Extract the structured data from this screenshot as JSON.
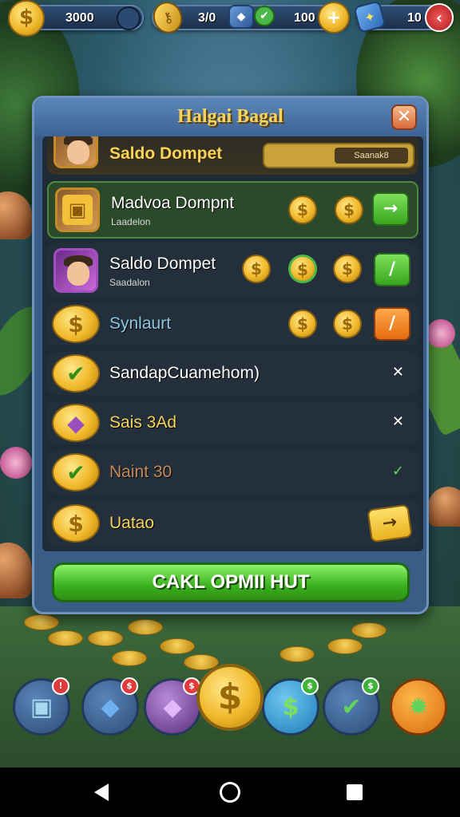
{
  "topbar": {
    "coins": "3000",
    "keys": "3/0",
    "gems": "100",
    "tickets": "10"
  },
  "modal": {
    "title": "Halgai Bagal",
    "close_label": "✕",
    "top_row": {
      "label": "Saldo Dompet",
      "field_value": "Saanak8"
    },
    "rows": [
      {
        "title": "Madvoa Dompnt",
        "sub": "Laadelon"
      },
      {
        "title": "Saldo Dompet",
        "sub": "Saadalon"
      },
      {
        "title": "Synlaurt"
      },
      {
        "title": "SandapCuamehom)"
      },
      {
        "title": "Sais 3Ad"
      },
      {
        "title": "Naint 30"
      },
      {
        "title": "Uatao"
      }
    ],
    "cta_label": "CAKL OPMII HUT"
  },
  "icons": {
    "coin": "$",
    "arrow": "→",
    "pencil": "/",
    "close_mark": "✕",
    "check_mark": "✓",
    "leaf": "✔",
    "gear": "✹",
    "cube": "◆",
    "gift": "▣"
  },
  "dock": {
    "badge_1": "!",
    "badge_2": "$",
    "badge_3": "$",
    "badge_4": "$",
    "badge_5": "$"
  },
  "colors": {
    "title_gold": "#f7d35a",
    "cta_green": "#39b11c",
    "modal_blue": "#3a5d87"
  }
}
